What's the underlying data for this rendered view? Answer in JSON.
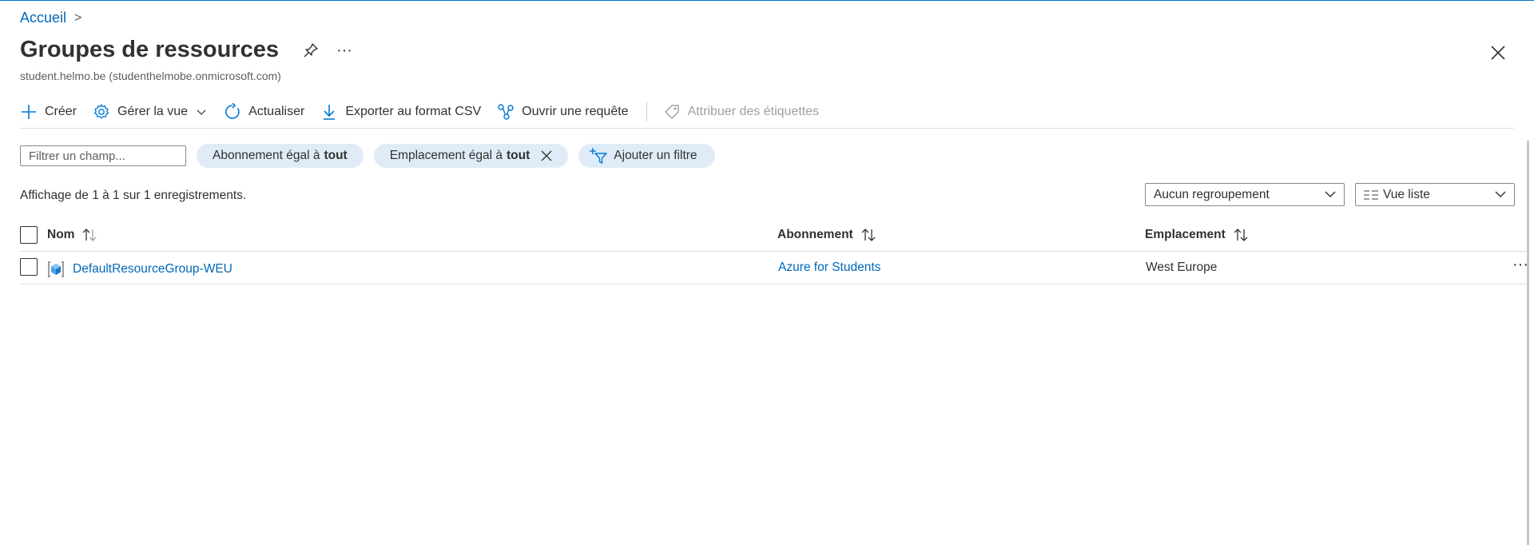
{
  "breadcrumb": {
    "home": "Accueil",
    "separator": ">"
  },
  "header": {
    "title": "Groupes de ressources",
    "subtitle": "student.helmo.be (studenthelmobe.onmicrosoft.com)",
    "more": "···"
  },
  "toolbar": {
    "create": "Créer",
    "manage_view": "Gérer la vue",
    "refresh": "Actualiser",
    "export_csv": "Exporter au format CSV",
    "open_query": "Ouvrir une requête",
    "assign_tags": "Attribuer des étiquettes"
  },
  "filters": {
    "search_placeholder": "Filtrer un champ...",
    "subscription_prefix": "Abonnement égal à",
    "subscription_value": "tout",
    "location_prefix": "Emplacement égal à",
    "location_value": "tout",
    "add_filter": "Ajouter un filtre"
  },
  "records": {
    "summary": "Affichage de 1 à 1 sur 1 enregistrements."
  },
  "grouping": {
    "selected": "Aucun regroupement"
  },
  "view": {
    "selected": "Vue liste"
  },
  "table": {
    "columns": [
      "Nom",
      "Abonnement",
      "Emplacement"
    ],
    "rows": [
      {
        "name": "DefaultResourceGroup-WEU",
        "subscription": "Azure for Students",
        "location": "West Europe",
        "more": "···"
      }
    ]
  },
  "colors": {
    "accent": "#0078d4",
    "link": "#0067b8",
    "pill": "#dfecf8"
  },
  "icons": [
    "pin-icon",
    "close-icon",
    "plus-icon",
    "gear-icon",
    "chevron-down-icon",
    "refresh-icon",
    "download-icon",
    "query-icon",
    "tag-icon",
    "filter-add-icon",
    "sort-icon",
    "resource-group-icon",
    "list-view-icon"
  ]
}
